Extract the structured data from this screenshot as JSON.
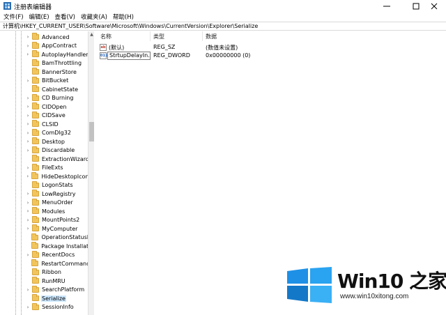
{
  "window": {
    "title": "注册表编辑器"
  },
  "menu": [
    "文件(F)",
    "编辑(E)",
    "查看(V)",
    "收藏夹(A)",
    "帮助(H)"
  ],
  "address": "计算机\\HKEY_CURRENT_USER\\Software\\Microsoft\\Windows\\CurrentVersion\\Explorer\\Serialize",
  "tree": {
    "items": [
      {
        "label": "Advanced",
        "expandable": true
      },
      {
        "label": "AppContract",
        "expandable": true
      },
      {
        "label": "AutoplayHandlers",
        "expandable": true
      },
      {
        "label": "BamThrottling",
        "expandable": false
      },
      {
        "label": "BannerStore",
        "expandable": false
      },
      {
        "label": "BitBucket",
        "expandable": true
      },
      {
        "label": "CabinetState",
        "expandable": false
      },
      {
        "label": "CD Burning",
        "expandable": true
      },
      {
        "label": "CIDOpen",
        "expandable": true
      },
      {
        "label": "CIDSave",
        "expandable": true
      },
      {
        "label": "CLSID",
        "expandable": true
      },
      {
        "label": "ComDlg32",
        "expandable": true
      },
      {
        "label": "Desktop",
        "expandable": true
      },
      {
        "label": "Discardable",
        "expandable": true
      },
      {
        "label": "ExtractionWizard",
        "expandable": false
      },
      {
        "label": "FileExts",
        "expandable": true
      },
      {
        "label": "HideDesktopIcons",
        "expandable": true
      },
      {
        "label": "LogonStats",
        "expandable": false
      },
      {
        "label": "LowRegistry",
        "expandable": true
      },
      {
        "label": "MenuOrder",
        "expandable": true
      },
      {
        "label": "Modules",
        "expandable": true
      },
      {
        "label": "MountPoints2",
        "expandable": true
      },
      {
        "label": "MyComputer",
        "expandable": true
      },
      {
        "label": "OperationStatusM",
        "expandable": false
      },
      {
        "label": "Package Installatic",
        "expandable": false
      },
      {
        "label": "RecentDocs",
        "expandable": true
      },
      {
        "label": "RestartCommands",
        "expandable": false
      },
      {
        "label": "Ribbon",
        "expandable": false
      },
      {
        "label": "RunMRU",
        "expandable": false
      },
      {
        "label": "SearchPlatform",
        "expandable": true
      },
      {
        "label": "Serialize",
        "expandable": false,
        "selected": true
      },
      {
        "label": "SessionInfo",
        "expandable": true
      }
    ]
  },
  "list": {
    "headers": [
      "名称",
      "类型",
      "数据"
    ],
    "rows": [
      {
        "icon": "ab",
        "name": "(默认)",
        "type": "REG_SZ",
        "data": "(数值未设置)"
      },
      {
        "icon": "bin",
        "name": "StrtupDelayIn...",
        "type": "REG_DWORD",
        "data": "0x00000000 (0)",
        "editing": true
      }
    ]
  },
  "watermark": {
    "title": "Win10 之家",
    "url": "www.win10xitong.com",
    "colors": [
      "#1e90e6",
      "#2aa3f0",
      "#1478c8",
      "#3ab0f5"
    ]
  }
}
